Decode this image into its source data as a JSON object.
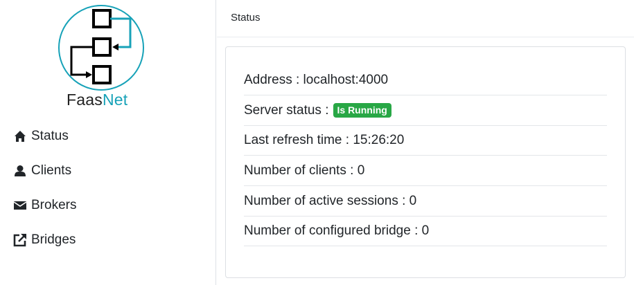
{
  "brand": {
    "name_part1": "Faas",
    "name_part2": "Net",
    "accent_color": "#17a2b8"
  },
  "sidebar": {
    "items": [
      {
        "label": "Status",
        "icon": "home-icon"
      },
      {
        "label": "Clients",
        "icon": "user-icon"
      },
      {
        "label": "Brokers",
        "icon": "envelope-icon"
      },
      {
        "label": "Bridges",
        "icon": "external-link-icon"
      }
    ]
  },
  "header": {
    "title": "Status"
  },
  "status": {
    "address_label": "Address",
    "address_value": "localhost:4000",
    "server_status_label": "Server status",
    "server_status_badge": "Is Running",
    "badge_color": "#28a745",
    "refresh_label": "Last refresh time",
    "refresh_value": "15:26:20",
    "clients_label": "Number of clients",
    "clients_value": "0",
    "sessions_label": "Number of active sessions",
    "sessions_value": "0",
    "bridges_label": "Number of configured bridge",
    "bridges_value": "0"
  }
}
